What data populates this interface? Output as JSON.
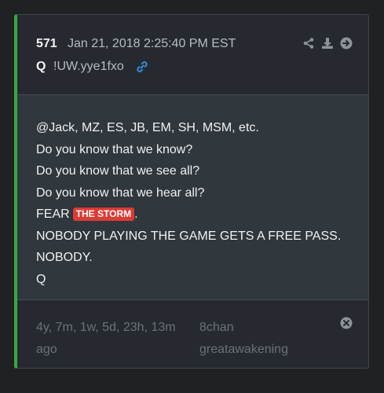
{
  "post": {
    "number": "571",
    "timestamp": "Jan 21, 2018 2:25:40 PM EST",
    "author": "Q",
    "tripcode": "!UW.yye1fxo",
    "lines": [
      "@Jack, MZ, ES, JB, EM, SH, MSM, etc.",
      "Do you know that we know?",
      "Do you know that we see all?",
      "Do you know that we hear all?",
      "FEAR",
      "NOBODY PLAYING THE GAME GETS A FREE PASS.",
      "NOBODY.",
      "Q"
    ],
    "badge": "THE STORM",
    "badge_suffix": ".",
    "age_line1": "4y, 7m, 1w, 5d, 23h, 13m",
    "age_line2": "ago",
    "board_line1": "8chan",
    "board_line2": "greatawakening"
  },
  "icons": [
    "share-icon",
    "download-icon",
    "arrow-right-circle-icon",
    "link-icon",
    "close-circle-icon"
  ],
  "colors": {
    "accent_border": "#39a845",
    "badge": "#dd3a35",
    "link": "#2e8fd9"
  }
}
